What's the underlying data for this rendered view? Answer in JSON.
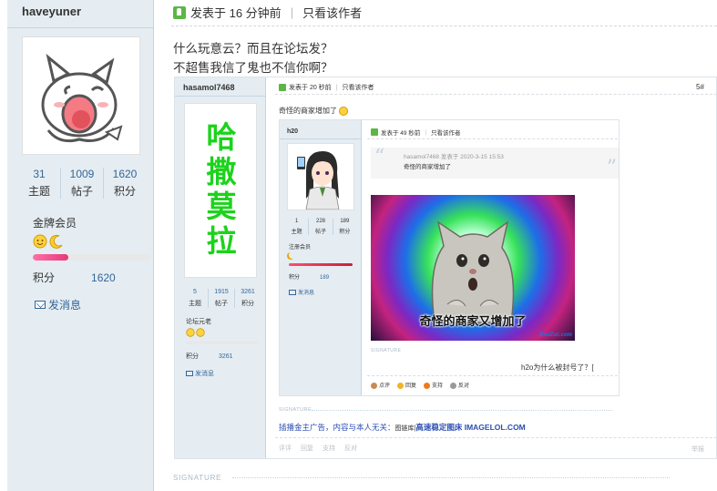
{
  "sidebar": {
    "username": "haveyuner",
    "stats": [
      {
        "value": "31",
        "label": "主题"
      },
      {
        "value": "1009",
        "label": "帖子"
      },
      {
        "value": "1620",
        "label": "积分"
      }
    ],
    "rank": "金牌会员",
    "points_label": "积分",
    "points_value": "1620",
    "progress_fraction": 0.3,
    "message_label": "发消息"
  },
  "post": {
    "posted_at": "发表于 16 分钟前",
    "author_only": "只看该作者",
    "line1": "什么玩意云？而且在论坛发？",
    "line2": "不超售我信了鬼也不信你啊？"
  },
  "screenshot": {
    "username": "hasamol7468",
    "avatar_text": [
      "哈",
      "撒",
      "莫",
      "拉"
    ],
    "stats": [
      {
        "value": "5",
        "label": "主题"
      },
      {
        "value": "1915",
        "label": "帖子"
      },
      {
        "value": "3261",
        "label": "积分"
      }
    ],
    "rank": "论坛元老",
    "points_label": "积分",
    "points_value": "3261",
    "message_label": "发消息",
    "posted_at": "发表于 20 秒前",
    "author_only": "只看该作者",
    "floor": "5#",
    "text": "奇怪的商家增加了",
    "signature_label": "SIGNATURE",
    "ad_text": "插播金主广告，内容与本人无关：",
    "ad_mid": "图链库",
    "ad_link": "高速稳定图床 IMAGELOL.COM",
    "actions": [
      "评评",
      "回复",
      "支持",
      "反对"
    ],
    "report": "举报"
  },
  "inner": {
    "username": "h20",
    "stats": [
      {
        "value": "1",
        "label": "主题"
      },
      {
        "value": "228",
        "label": "帖子"
      },
      {
        "value": "189",
        "label": "积分"
      }
    ],
    "rank": "注册会员",
    "points_label": "积分",
    "points_value": "189",
    "message_label": "发消息",
    "posted_at": "发表于 49 秒前",
    "author_only": "只看该作者",
    "quote_meta": "hasamol7468 发表于 2020-3-15 15:53",
    "quote_text": "奇怪的商家增加了",
    "meme_caption": "奇怪的商家又增加了",
    "meme_watermark": "RoaZuc.com",
    "signature_label": "SIGNATURE",
    "reply": "h2o为什么被封号了？[",
    "actions": [
      "点评",
      "回复",
      "支持",
      "反对"
    ]
  },
  "main_signature_label": "SIGNATURE",
  "colors": {
    "sidebar_bg": "#e5edf2",
    "link": "#336699",
    "progress": "#e6397a",
    "avatar_text": "#1bd31b"
  }
}
